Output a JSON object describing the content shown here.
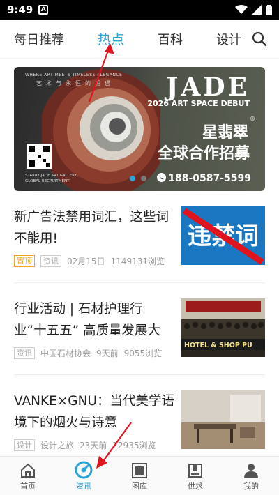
{
  "status": {
    "time": "9:49",
    "a_badge": "A"
  },
  "tabs": [
    {
      "label": "每日推荐"
    },
    {
      "label": "热点"
    },
    {
      "label": "百科"
    },
    {
      "label": "设计"
    }
  ],
  "banner": {
    "line1": "WHERE ART MEETS TIMELESS ELEGANCE",
    "line2": "艺术与永恒的相遇",
    "jade": "JADE",
    "debut": "2026 ART SPACE DEBUT",
    "brand": "星翡翠",
    "reg": "®",
    "slogan": "全球合作招募",
    "phone": "188-0587-5599",
    "gallery1": "STARRY JADE ART GALLERY",
    "gallery2": "GLOBAL RECRUITMENT"
  },
  "feed": [
    {
      "title": "新广告法禁用词汇，这些词不能用!",
      "tags": [
        "置顶",
        "资讯"
      ],
      "date": "02月15日",
      "views": "1149131浏览",
      "thumb_text": "违禁词"
    },
    {
      "title": "行业活动 | 石材护理行业“十五五” 高质量发展大会...",
      "tags": [
        "资讯"
      ],
      "source": "中国石材协会",
      "date": "9天前",
      "views": "9055浏览",
      "thumb_text": "HOTEL & SHOP PU"
    },
    {
      "title": "VANKE×GNU：当代美学语境下的烟火与诗意",
      "tags": [
        "设计"
      ],
      "source": "设计之旅",
      "date": "23天前",
      "views": "22935浏览"
    }
  ],
  "nav": [
    {
      "label": "首页"
    },
    {
      "label": "资讯"
    },
    {
      "label": "图库"
    },
    {
      "label": "供求"
    },
    {
      "label": "我的"
    }
  ],
  "colors": {
    "accent": "#2aa3d6",
    "arrow": "#e0141e",
    "top_tag": "#f5a623"
  }
}
